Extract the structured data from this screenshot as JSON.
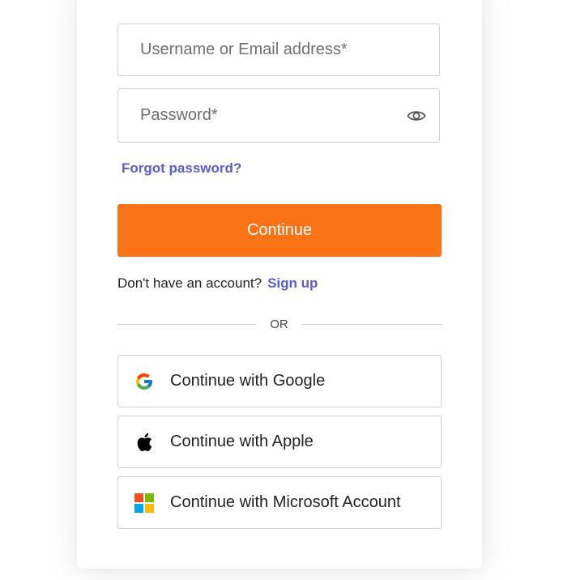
{
  "form": {
    "username_placeholder": "Username or Email address*",
    "username_value": "",
    "password_placeholder": "Password*",
    "password_value": "",
    "forgot_password_label": "Forgot password?",
    "continue_label": "Continue",
    "no_account_text": "Don't have an account?",
    "signup_label": "Sign up",
    "divider_text": "OR"
  },
  "sso": {
    "google_label": "Continue with Google",
    "apple_label": "Continue with Apple",
    "microsoft_label": "Continue with Microsoft Account"
  },
  "icons": {
    "eye": "eye-icon",
    "google": "google-icon",
    "apple": "apple-icon",
    "microsoft": "microsoft-icon"
  },
  "colors": {
    "accent": "#f97316",
    "link": "#5b5bd6",
    "border": "#cfcfcf"
  }
}
